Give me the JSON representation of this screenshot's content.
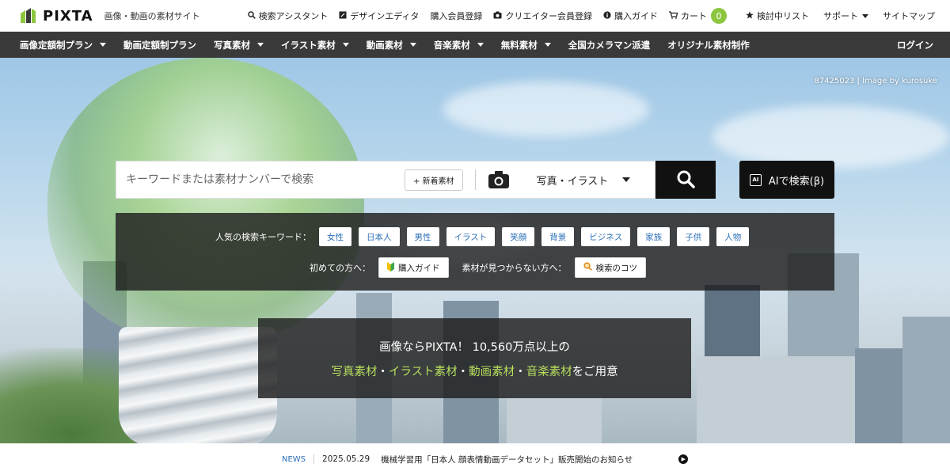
{
  "header": {
    "logo_text": "PIXTA",
    "tagline": "画像・動画の素材サイト",
    "links": [
      {
        "label": "検索アシスタント",
        "icon": "search-icon"
      },
      {
        "label": "デザインエディタ",
        "icon": "edit-icon"
      },
      {
        "label": "購入会員登録",
        "icon": ""
      },
      {
        "label": "クリエイター会員登録",
        "icon": "camera-icon"
      },
      {
        "label": "購入ガイド",
        "icon": "info-icon"
      },
      {
        "label": "カート",
        "icon": "cart-icon"
      },
      {
        "label": "検討中リスト",
        "icon": "star-icon"
      },
      {
        "label": "サポート",
        "icon": ""
      },
      {
        "label": "サイトマップ",
        "icon": ""
      }
    ],
    "cart_count": "0"
  },
  "nav": {
    "items": [
      {
        "label": "画像定額制プラン",
        "dropdown": true
      },
      {
        "label": "動画定額制プラン",
        "dropdown": false
      },
      {
        "label": "写真素材",
        "dropdown": true
      },
      {
        "label": "イラスト素材",
        "dropdown": true
      },
      {
        "label": "動画素材",
        "dropdown": true
      },
      {
        "label": "音楽素材",
        "dropdown": true
      },
      {
        "label": "無料素材",
        "dropdown": true
      },
      {
        "label": "全国カメラマン派遣",
        "dropdown": false
      },
      {
        "label": "オリジナル素材制作",
        "dropdown": false
      }
    ],
    "login": "ログイン"
  },
  "hero": {
    "credit": "87425023 | Image by kurosuke"
  },
  "search": {
    "placeholder": "キーワードまたは素材ナンバーで検索",
    "new_button": "+ 新着素材",
    "category": "写真・イラスト",
    "ai_button": "AIで検索(β)",
    "ai_icon_text": "AI"
  },
  "keywords": {
    "popular_label": "人気の検索キーワード：",
    "popular": [
      "女性",
      "日本人",
      "男性",
      "イラスト",
      "笑顔",
      "背景",
      "ビジネス",
      "家族",
      "子供",
      "人物"
    ],
    "first_label": "初めての方へ：",
    "guide_button": "購入ガイド",
    "notfound_label": "素材が見つからない方へ：",
    "tips_button": "検索のコツ"
  },
  "promo": {
    "line1": "画像ならPIXTA！ 10,560万点以上の",
    "items": [
      "写真素材",
      "イラスト素材",
      "動画素材",
      "音楽素材"
    ],
    "sep": "・",
    "suffix": "をご用意"
  },
  "news": {
    "label": "NEWS",
    "date": "2025.05.29",
    "text": "機械学習用「日本人 顔表情動画データセット」販売開始のお知らせ"
  },
  "colors": {
    "accent_green": "#8cc63f",
    "link_blue": "#2a6fb8",
    "nav_bg": "#3a3a3a"
  }
}
